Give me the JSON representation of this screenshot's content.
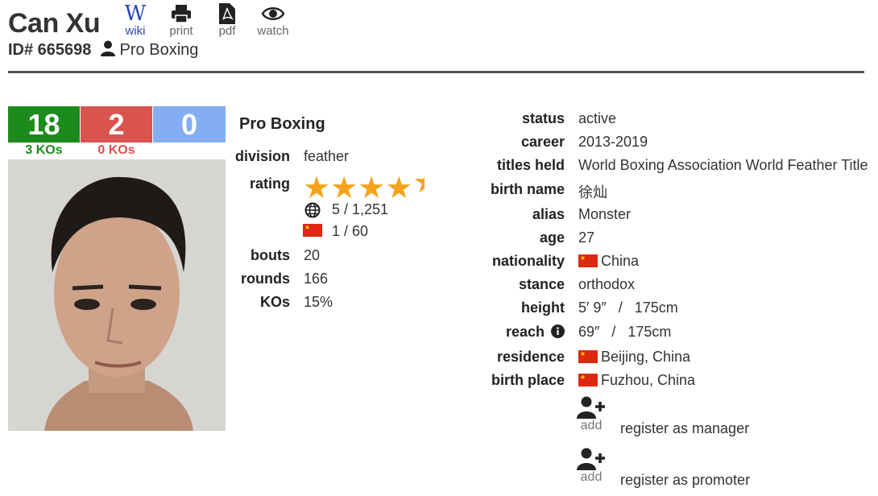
{
  "header": {
    "name": "Can Xu",
    "id_label": "ID# 665698",
    "sport": "Pro Boxing",
    "tools": [
      {
        "label": "wiki",
        "icon": "wikipedia-icon"
      },
      {
        "label": "print",
        "icon": "printer-icon"
      },
      {
        "label": "pdf",
        "icon": "pdf-icon"
      },
      {
        "label": "watch",
        "icon": "eye-icon"
      }
    ]
  },
  "record": {
    "wins": "18",
    "losses": "2",
    "draws": "0",
    "wins_kos": "3 KOs",
    "losses_kos": "0 KOs",
    "colors": {
      "wins": "#1d8a1d",
      "losses": "#d9534f",
      "draws": "#84aef2"
    }
  },
  "stats": {
    "section_title": "Pro Boxing",
    "division_label": "division",
    "division": "feather",
    "rating_label": "rating",
    "rating_stars": 4.5,
    "world_rank": "5 / 1,251",
    "country_rank": "1 / 60",
    "bouts_label": "bouts",
    "bouts": "20",
    "rounds_label": "rounds",
    "rounds": "166",
    "kos_label": "KOs",
    "kos": "15%"
  },
  "bio": {
    "status_label": "status",
    "status": "active",
    "career_label": "career",
    "career": "2013-2019",
    "titles_label": "titles held",
    "titles": "World Boxing Association World Feather Title",
    "birth_name_label": "birth name",
    "birth_name": "徐灿",
    "alias_label": "alias",
    "alias": "Monster",
    "age_label": "age",
    "age": "27",
    "nationality_label": "nationality",
    "nationality": "China",
    "stance_label": "stance",
    "stance": "orthodox",
    "height_label": "height",
    "height": "5′ 9″   /   175cm",
    "reach_label": "reach",
    "reach": "69″   /   175cm",
    "residence_label": "residence",
    "residence": "Beijing, China",
    "birth_place_label": "birth place",
    "birth_place": "Fuzhou, China"
  },
  "actions": {
    "add_label": "add",
    "manager": "register as manager",
    "promoter": "register as promoter"
  }
}
